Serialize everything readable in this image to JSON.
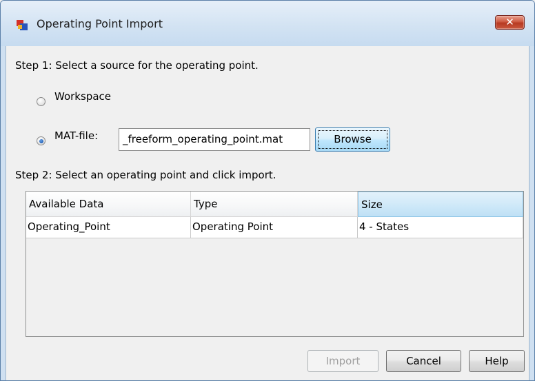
{
  "window": {
    "title": "Operating Point Import",
    "close_glyph": "✕",
    "icon": "simulink-app-icon"
  },
  "step1": {
    "label": "Step 1: Select a source for the operating point.",
    "workspace_label": "Workspace",
    "workspace_selected": false,
    "matfile_label": "MAT-file:",
    "matfile_selected": true,
    "matfile_value": "_freeform_operating_point.mat",
    "browse_label": "Browse"
  },
  "step2": {
    "label": "Step 2: Select an operating point and click import."
  },
  "table": {
    "columns": [
      "Available Data",
      "Type",
      "Size"
    ],
    "sorted_column": "Size",
    "rows": [
      [
        "Operating_Point",
        "Operating Point",
        "4 - States"
      ]
    ]
  },
  "buttons": {
    "import_label": "Import",
    "import_enabled": false,
    "cancel_label": "Cancel",
    "help_label": "Help"
  },
  "colors": {
    "title_bar": "#d3e3f3",
    "close_button": "#c9573e",
    "selected_header": "#cde8f8"
  }
}
